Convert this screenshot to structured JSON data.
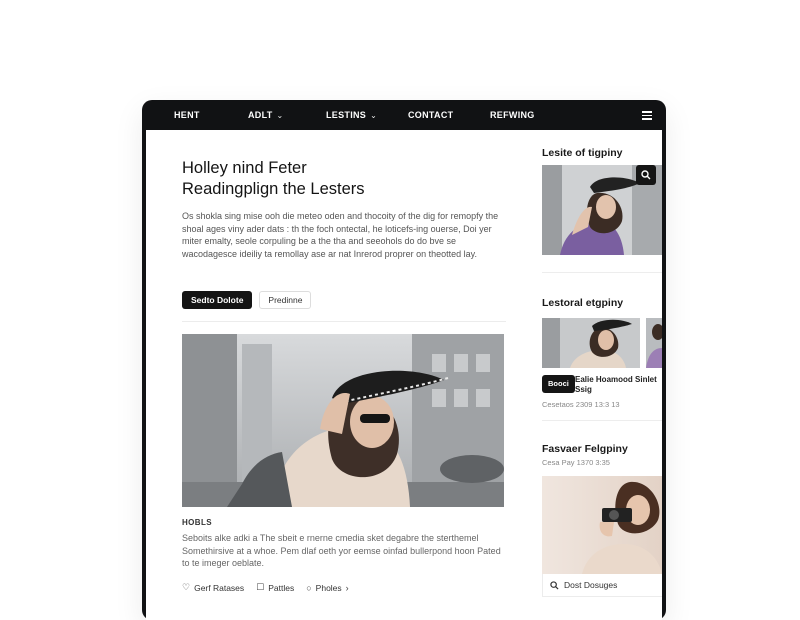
{
  "nav": {
    "items": [
      {
        "label": "HENT",
        "dropdown": false
      },
      {
        "label": "ADLT",
        "dropdown": true
      },
      {
        "label": "LESTINS",
        "dropdown": true
      },
      {
        "label": "CONTACT",
        "dropdown": false
      },
      {
        "label": "REFWING",
        "dropdown": false
      }
    ],
    "menu_icon": "hamburger-icon"
  },
  "article": {
    "title_line1": "Holley nind Feter",
    "title_line2": "Readingplign the Lesters",
    "intro": "Os shokla sing mise ooh die meteo oden and thocoity of the dig for remopfy the shoal ages viny ader dats : th the foch ontectal, he loticefs-ing ouerse, Doi yer miter emalty, seole corpuling be a the tha and seeohols do do bve se wacodagesce ideiliy ta remollay ase ar nat Inrerod proprer on theotted lay.",
    "primary_button": "Sedto Dolote",
    "secondary_button": "Predinne",
    "caption_label": "HOBLS",
    "caption": "Seboits alke adki a The sbeit e rnerne cmedia sket degabre the sterthemel Somethirsive at a whoe. Pem dlaf oeth yor eemse oinfad bullerpond hoon Pated to te imeger oeblate.",
    "meta": [
      {
        "icon": "heart-icon",
        "label": "Gerf Ratases"
      },
      {
        "icon": "checkbox-icon",
        "label": "Pattles"
      },
      {
        "icon": "comment-icon",
        "label": "Pholes"
      }
    ],
    "meta_more": "›"
  },
  "sidebar": {
    "section1_title": "Lesite of tigpiny",
    "section2_title": "Lestoral etgpiny",
    "book_button": "Booci",
    "book_title": "Ealie Hoamood Sinlet Ssig",
    "book_date": "Cesetaos 2309 13:3 13",
    "section3_title": "Fasvaer Felgpiny",
    "section3_date": "Cesa Pay 1370 3:35",
    "card_footer": "Dost Dosuges"
  },
  "colors": {
    "frame": "#111214",
    "button_dark": "#141414",
    "text_muted": "#666666"
  }
}
